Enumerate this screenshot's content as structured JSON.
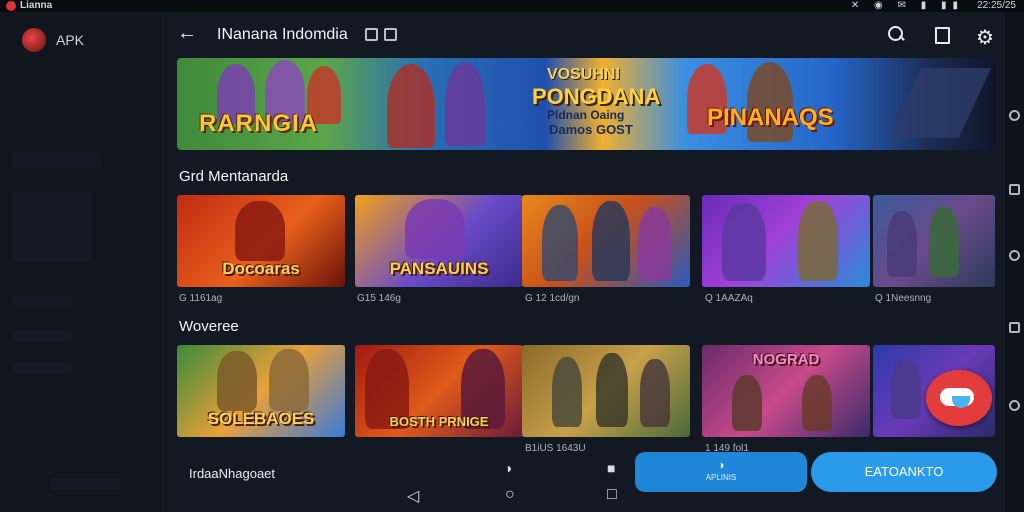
{
  "status_bar": {
    "app_name": "Lianna",
    "clock": "22:25/25",
    "icons": "✕ ◉ ✉ ▮ ▮▮"
  },
  "left_panel": {
    "app_label": "APK"
  },
  "header": {
    "title": "INanana Indomdia"
  },
  "banner": {
    "left_text": "RARNGIA",
    "center_line1": "VOSUHNI",
    "center_line2": "PONGDANA",
    "center_line3": "Pldnan Oaing",
    "center_line4": "Damos GOST",
    "right_text": "PINANAQS"
  },
  "sections": [
    {
      "title": "Grd Mentanarda",
      "cards": [
        {
          "art_text": "Docoaras",
          "meta": "G 1161ag"
        },
        {
          "art_text": "PANSAUINS",
          "meta": "G15 146g"
        },
        {
          "art_text": "",
          "meta": "G 12 1cd/gn"
        },
        {
          "art_text": "",
          "meta": "Q 1AAZAq"
        },
        {
          "art_text": "",
          "meta": "Q 1Neesnng"
        }
      ]
    },
    {
      "title": "Woveree",
      "cards": [
        {
          "art_text": "SOLEBAOES",
          "meta": ""
        },
        {
          "art_text": "BOSTH PRNIGE",
          "meta": ""
        },
        {
          "art_text": "",
          "meta": "B1iUS 1643U"
        },
        {
          "art_text": "NOGRAD",
          "meta": "1 149 fol1"
        },
        {
          "art_text": "",
          "meta": ""
        }
      ]
    }
  ],
  "bottom_bar": {
    "label": "IrdaaNhagoaet",
    "secondary_button": "APLINIS",
    "primary_button": "EATOANKTO"
  },
  "colors": {
    "accent": "#2a9bea",
    "background": "#131923",
    "fab": "#e33c3c"
  }
}
